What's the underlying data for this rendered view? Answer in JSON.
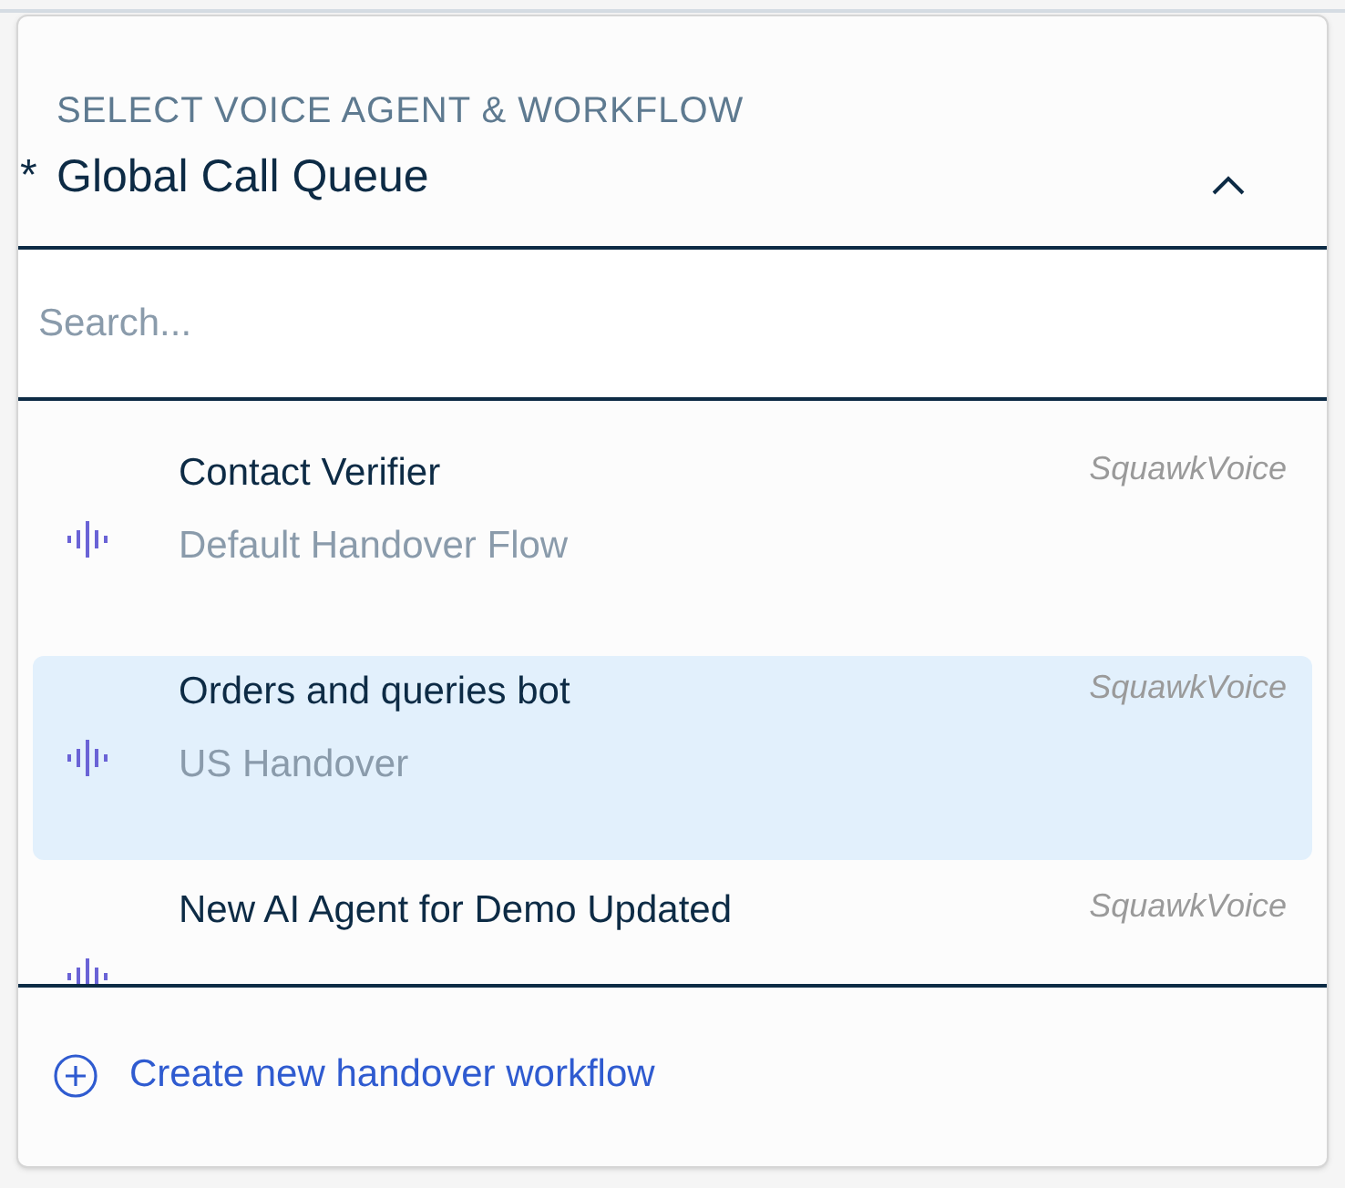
{
  "label": "SELECT VOICE AGENT & WORKFLOW",
  "required_mark": "*",
  "value": "Global Call Queue",
  "expanded": true,
  "search": {
    "placeholder": "Search..."
  },
  "options": [
    {
      "title": "Contact Verifier",
      "subtitle": "Default Handover Flow",
      "provider": "SquawkVoice",
      "selected": false
    },
    {
      "title": "Orders and queries bot",
      "subtitle": "US Handover",
      "provider": "SquawkVoice",
      "selected": true
    },
    {
      "title": "New AI Agent for Demo Updated",
      "provider": "SquawkVoice",
      "selected": false
    }
  ],
  "create_link": "Create new handover workflow"
}
